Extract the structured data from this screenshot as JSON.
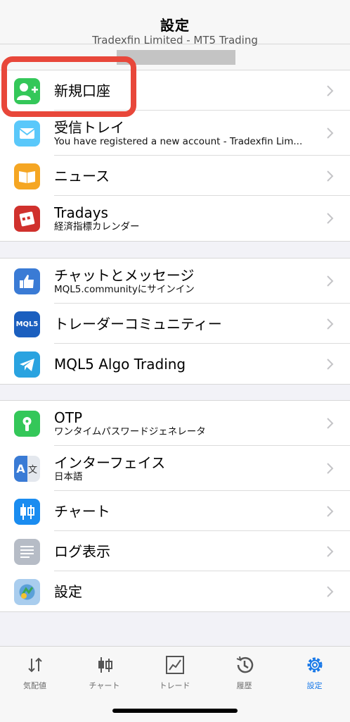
{
  "header": {
    "title": "設定",
    "account_line": "Tradexfin Limited - MT5 Trading"
  },
  "sections": [
    {
      "items": [
        {
          "id": "new-account",
          "title": "新規口座",
          "subtitle": "",
          "icon": "add-person-icon",
          "color": "#34c759"
        },
        {
          "id": "inbox",
          "title": "受信トレイ",
          "subtitle": "You have registered a new account - Tradexfin Lim...",
          "icon": "mail-icon",
          "color": "#5ac8fa"
        },
        {
          "id": "news",
          "title": "ニュース",
          "subtitle": "",
          "icon": "book-icon",
          "color": "#f5a623"
        },
        {
          "id": "tradays",
          "title": "Tradays",
          "subtitle": "経済指標カレンダー",
          "icon": "calendar-icon",
          "color": "#d0312d"
        }
      ]
    },
    {
      "items": [
        {
          "id": "chat",
          "title": "チャットとメッセージ",
          "subtitle": "MQL5.communityにサインイン",
          "icon": "thumbs-up-icon",
          "color": "#3a7bd5"
        },
        {
          "id": "community",
          "title": "トレーダーコミュニティー",
          "subtitle": "",
          "icon": "mql5-logo-icon",
          "color": "#1b5fbf",
          "icon_text": "MQL5"
        },
        {
          "id": "algo",
          "title": "MQL5 Algo Trading",
          "subtitle": "",
          "icon": "telegram-icon",
          "color": "#2aa3e0"
        }
      ]
    },
    {
      "items": [
        {
          "id": "otp",
          "title": "OTP",
          "subtitle": "ワンタイムパスワードジェネレータ",
          "icon": "keyhole-icon",
          "color": "#34c759"
        },
        {
          "id": "interface",
          "title": "インターフェイス",
          "subtitle": "日本語",
          "icon": "translate-icon",
          "color": "#3a7bd5",
          "icon_text_a": "A",
          "icon_text_b": "文"
        },
        {
          "id": "charts",
          "title": "チャート",
          "subtitle": "",
          "icon": "candlestick-icon",
          "color": "#1a8cf0"
        },
        {
          "id": "journal",
          "title": "ログ表示",
          "subtitle": "",
          "icon": "log-icon",
          "color": "#b6bcc6"
        },
        {
          "id": "settings",
          "title": "設定",
          "subtitle": "",
          "icon": "app-settings-icon",
          "color": "#7fb3e0"
        }
      ]
    }
  ],
  "tabs": [
    {
      "label": "気配値",
      "icon": "quotes-icon",
      "active": false
    },
    {
      "label": "チャート",
      "icon": "chart-icon",
      "active": false
    },
    {
      "label": "トレード",
      "icon": "trade-icon",
      "active": false
    },
    {
      "label": "履歴",
      "icon": "history-icon",
      "active": false
    },
    {
      "label": "設定",
      "icon": "settings-gear-icon",
      "active": true
    }
  ],
  "colors": {
    "active_tab": "#1677e8",
    "highlight": "#e8473a"
  }
}
